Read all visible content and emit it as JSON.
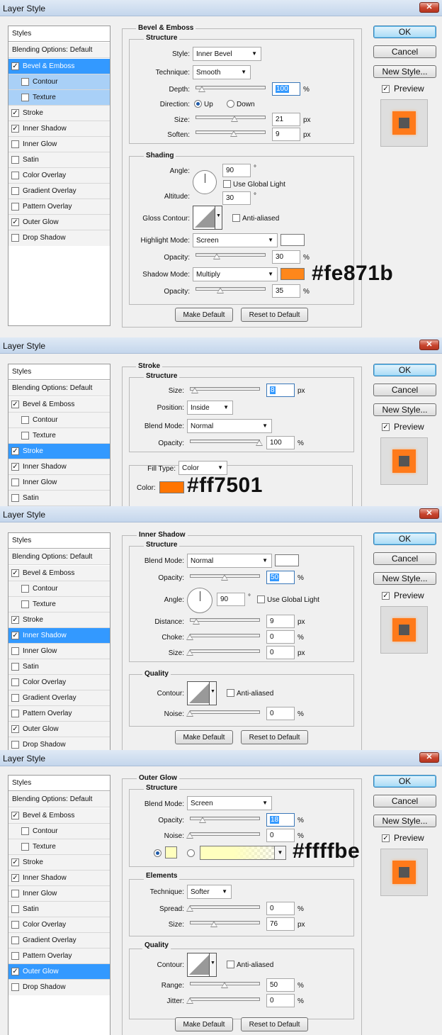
{
  "window_title": "Layer Style",
  "close_glyph": "✕",
  "check_glyph": "✓",
  "arrow_glyph": "▼",
  "styles_header": "Styles",
  "style_items": [
    "Blending Options: Default",
    "Bevel & Emboss",
    "Contour",
    "Texture",
    "Stroke",
    "Inner Shadow",
    "Inner Glow",
    "Satin",
    "Color Overlay",
    "Gradient Overlay",
    "Pattern Overlay",
    "Outer Glow",
    "Drop Shadow"
  ],
  "buttons": {
    "ok": "OK",
    "cancel": "Cancel",
    "new_style": "New Style...",
    "preview": "Preview",
    "make_default": "Make Default",
    "reset_default": "Reset to Default"
  },
  "preview_colors": {
    "outer": "#ff7a1a",
    "inner": "#555555"
  },
  "bevel": {
    "title": "Bevel & Emboss",
    "structure": "Structure",
    "style_label": "Style:",
    "style_value": "Inner Bevel",
    "technique_label": "Technique:",
    "technique_value": "Smooth",
    "depth_label": "Depth:",
    "depth_value": "100",
    "depth_unit": "%",
    "direction_label": "Direction:",
    "dir_up": "Up",
    "dir_down": "Down",
    "size_label": "Size:",
    "size_value": "21",
    "size_unit": "px",
    "soften_label": "Soften:",
    "soften_value": "9",
    "soften_unit": "px",
    "shading": "Shading",
    "angle_label": "Angle:",
    "angle_value": "90",
    "deg": "°",
    "global_light": "Use Global Light",
    "altitude_label": "Altitude:",
    "altitude_value": "30",
    "gloss_label": "Gloss Contour:",
    "anti_aliased": "Anti-aliased",
    "highlight_label": "Highlight Mode:",
    "highlight_value": "Screen",
    "highlight_color": "#ffffff",
    "hl_opacity_label": "Opacity:",
    "hl_opacity_value": "30",
    "pct": "%",
    "shadow_label": "Shadow Mode:",
    "shadow_value": "Multiply",
    "shadow_color": "#fe871b",
    "sh_opacity_label": "Opacity:",
    "sh_opacity_value": "35",
    "annotation": "#fe871b"
  },
  "stroke": {
    "title": "Stroke",
    "structure": "Structure",
    "size_label": "Size:",
    "size_value": "8",
    "size_unit": "px",
    "position_label": "Position:",
    "position_value": "Inside",
    "blend_label": "Blend Mode:",
    "blend_value": "Normal",
    "opacity_label": "Opacity:",
    "opacity_value": "100",
    "pct": "%",
    "filltype_label": "Fill Type:",
    "filltype_value": "Color",
    "color_label": "Color:",
    "color": "#ff7501",
    "annotation": "#ff7501"
  },
  "inner_shadow": {
    "title": "Inner Shadow",
    "structure": "Structure",
    "blend_label": "Blend Mode:",
    "blend_value": "Normal",
    "blend_color": "#ffffff",
    "opacity_label": "Opacity:",
    "opacity_value": "50",
    "pct": "%",
    "angle_label": "Angle:",
    "angle_value": "90",
    "deg": "°",
    "global_light": "Use Global Light",
    "distance_label": "Distance:",
    "distance_value": "9",
    "choke_label": "Choke:",
    "choke_value": "0",
    "size_label": "Size:",
    "size_value": "0",
    "px": "px",
    "quality": "Quality",
    "contour_label": "Contour:",
    "anti_aliased": "Anti-aliased",
    "noise_label": "Noise:",
    "noise_value": "0"
  },
  "outer_glow": {
    "title": "Outer Glow",
    "structure": "Structure",
    "blend_label": "Blend Mode:",
    "blend_value": "Screen",
    "opacity_label": "Opacity:",
    "opacity_value": "18",
    "pct": "%",
    "noise_label": "Noise:",
    "noise_value": "0",
    "glow_color": "#ffffbe",
    "annotation": "#ffffbe",
    "elements": "Elements",
    "technique_label": "Technique:",
    "technique_value": "Softer",
    "spread_label": "Spread:",
    "spread_value": "0",
    "size_label": "Size:",
    "size_value": "76",
    "px": "px",
    "quality": "Quality",
    "contour_label": "Contour:",
    "anti_aliased": "Anti-aliased",
    "range_label": "Range:",
    "range_value": "50",
    "jitter_label": "Jitter:",
    "jitter_value": "0"
  }
}
